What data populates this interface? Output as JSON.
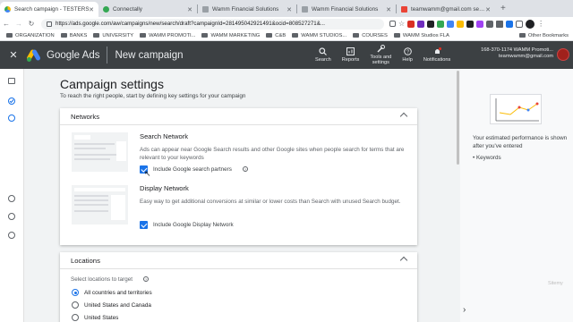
{
  "tabs": [
    {
      "label": "Search campaign - TESTERS",
      "active": true,
      "icon": "google-ads-icon"
    },
    {
      "label": "Connectally",
      "active": false,
      "icon": "location-pin-icon"
    },
    {
      "label": "Wamm Financial Solutions",
      "active": false,
      "icon": "page-icon"
    },
    {
      "label": "Wamm Financial Solutions",
      "active": false,
      "icon": "page-icon"
    },
    {
      "label": "teamwamm@gmail.com sent y",
      "active": false,
      "icon": "gmail-icon"
    }
  ],
  "address": {
    "url": "https://ads.google.com/aw/campaigns/new/search/draft?campaignId=281495042921491&ocid=808527271&..."
  },
  "bookmarks": [
    "ORGANIZATION",
    "BANKS",
    "UNIVERSITY",
    "WAMM PROMOTI...",
    "WAMM MARKETING",
    "C&B",
    "WAMM STUDIOS...",
    "COURSES",
    "WAMM Studios FLA"
  ],
  "bookmarks_other": "Other Bookmarks",
  "ads_header": {
    "brand": "Google Ads",
    "page_title": "New campaign",
    "tools": [
      {
        "label": "Search",
        "icon": "search-icon"
      },
      {
        "label": "Reports",
        "icon": "reports-icon"
      },
      {
        "label": "Tools and settings",
        "icon": "wrench-icon"
      },
      {
        "label": "Help",
        "icon": "help-icon"
      },
      {
        "label": "Notifications",
        "icon": "bell-icon"
      }
    ],
    "account_id": "168-370-1174 WAMM Promoti...",
    "account_email": "teamwamm@gmail.com"
  },
  "main": {
    "title": "Campaign settings",
    "subtitle": "To reach the right people, start by defining key settings for your campaign",
    "networks": {
      "header": "Networks",
      "search_title": "Search Network",
      "search_desc": "Ads can appear near Google Search results and other Google sites when people search for terms that are relevant to your keywords",
      "search_checkbox": "Include Google search partners",
      "search_checked": true,
      "display_title": "Display Network",
      "display_desc": "Easy way to get additional conversions at similar or lower costs than Search with unused Search budget.",
      "display_checkbox": "Include Google Display Network",
      "display_checked": true
    },
    "locations": {
      "header": "Locations",
      "prompt": "Select locations to target",
      "options": [
        "All countries and territories",
        "United States and Canada",
        "United States"
      ],
      "selected_index": 0
    }
  },
  "right_panel": {
    "estimate_text": "Your estimated performance is shown after you've entered",
    "bullet": "Keywords"
  },
  "watermark": "Sitemy",
  "colors": {
    "accent": "#1a73e8",
    "header_bg": "#3c4043"
  }
}
